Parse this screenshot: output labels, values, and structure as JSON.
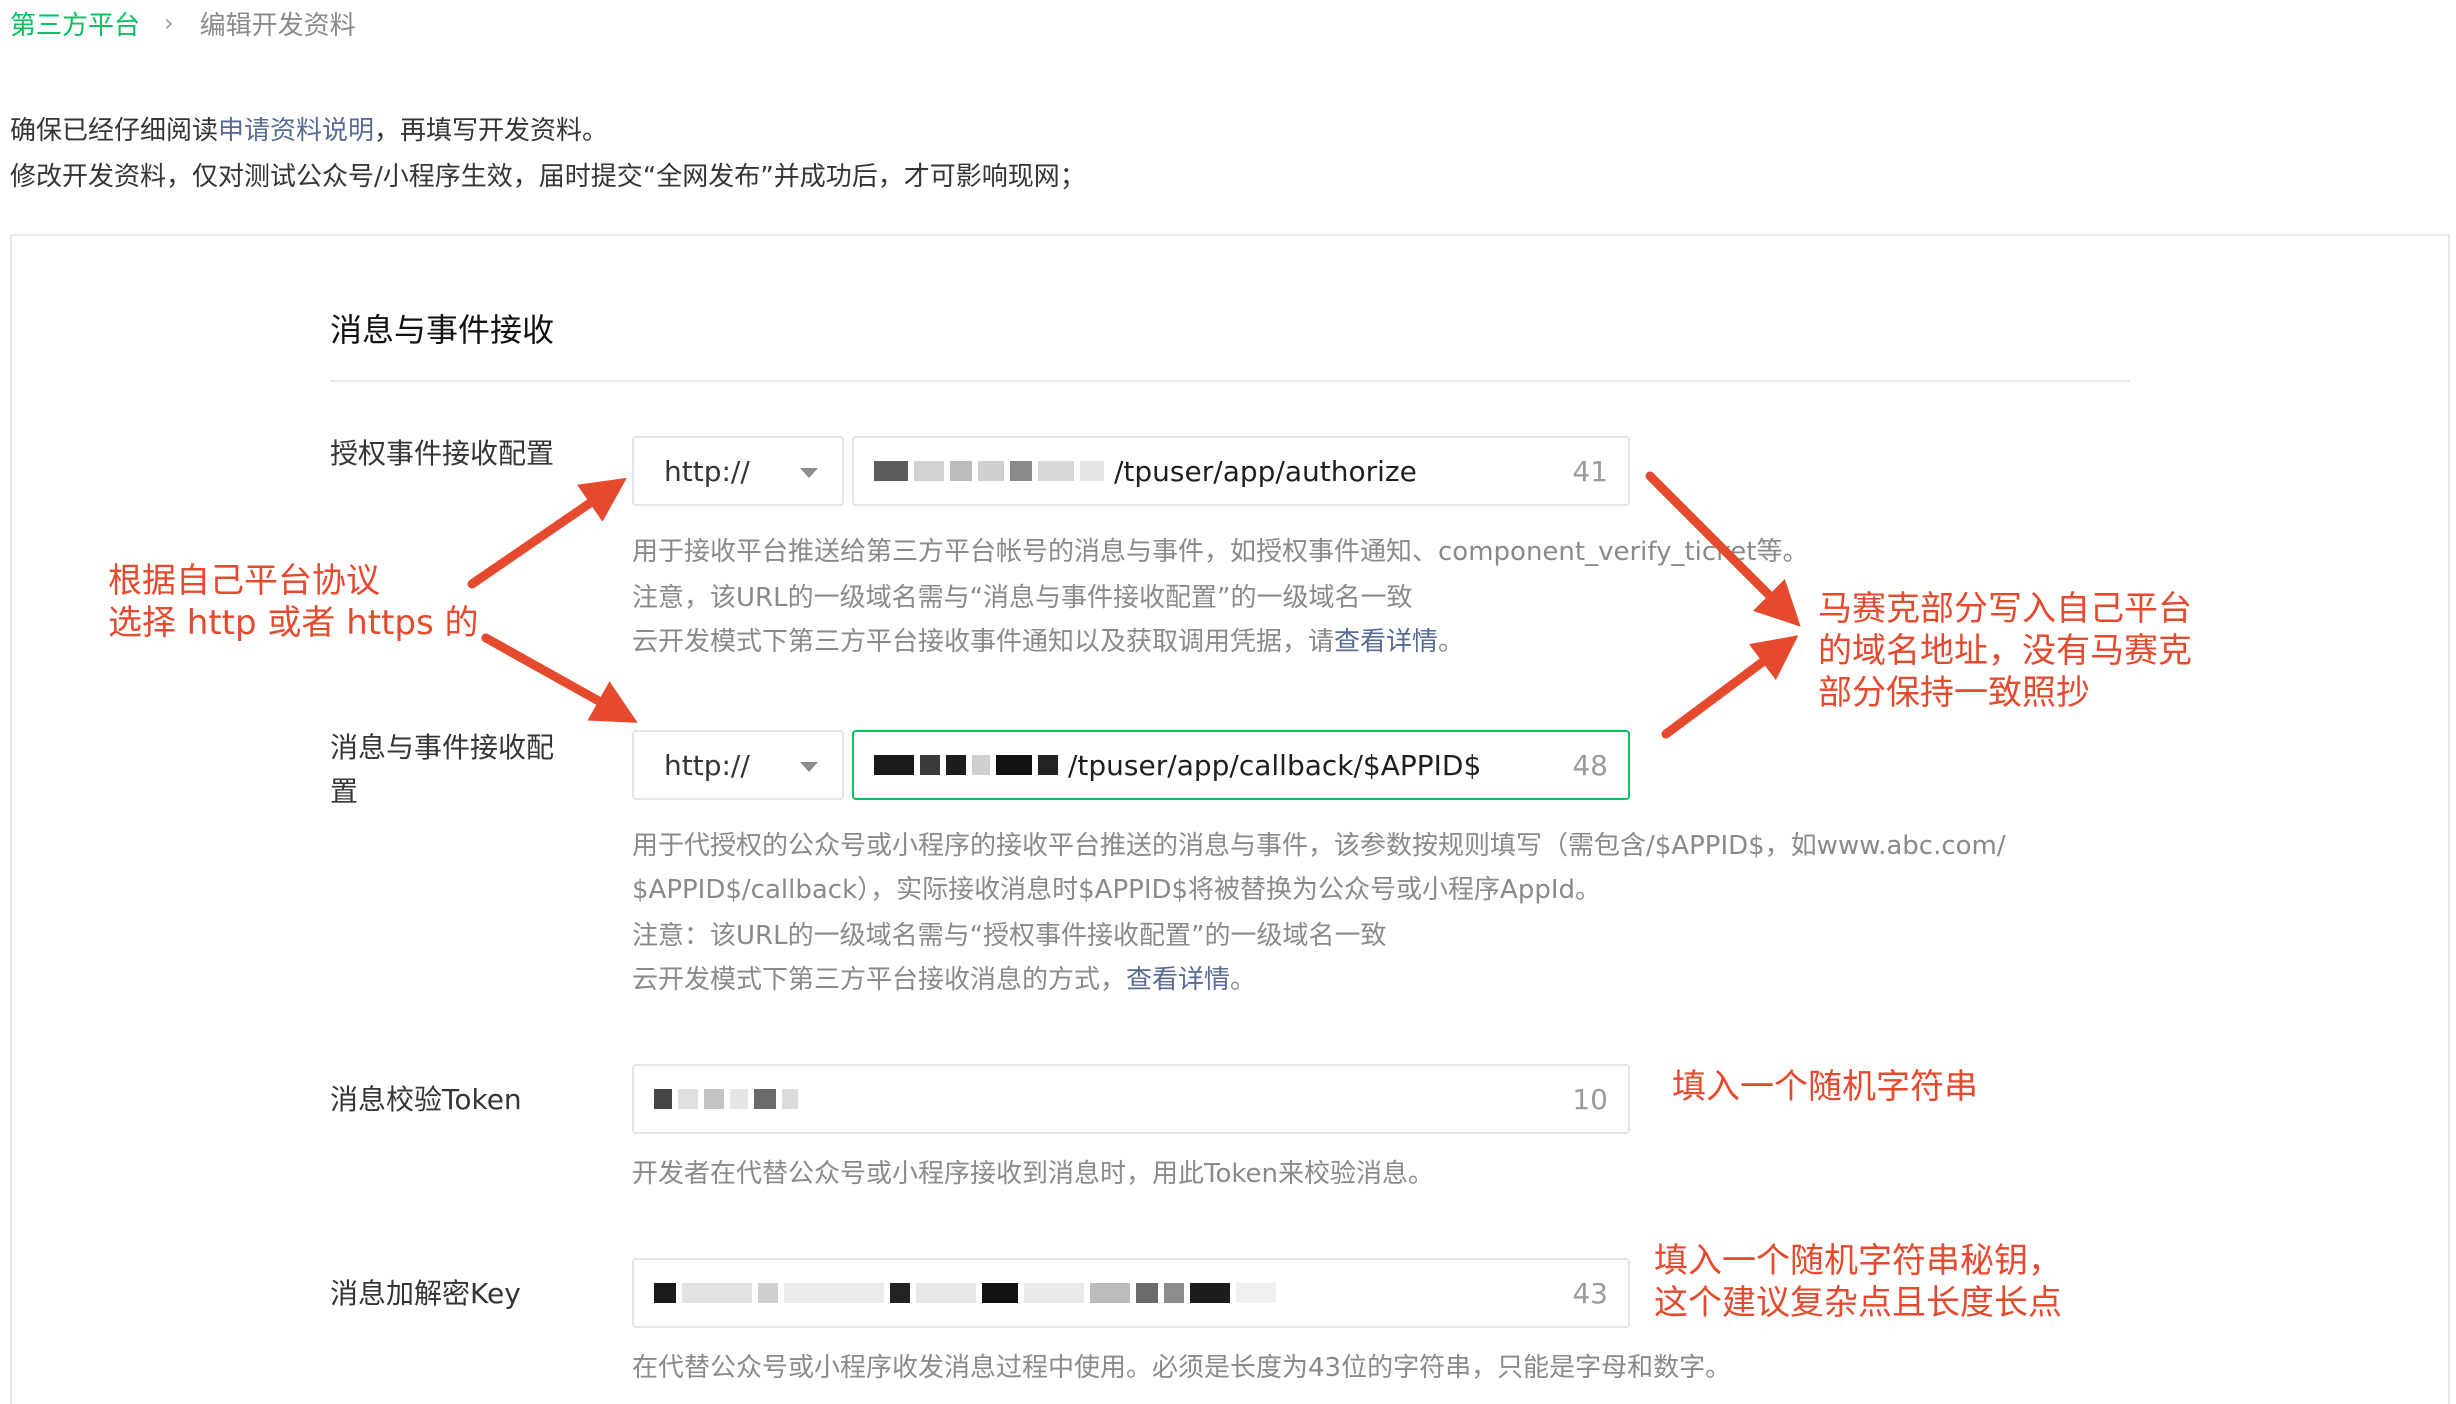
{
  "breadcrumb": {
    "root": "第三方平台",
    "separator": "›",
    "current": "编辑开发资料"
  },
  "intro": {
    "line1_prefix": "确保已经仔细阅读",
    "line1_link": "申请资料说明",
    "line1_suffix": "，再填写开发资料。",
    "line2": "修改开发资料，仅对测试公众号/小程序生效，届时提交“全网发布”并成功后，才可影响现网；"
  },
  "section": {
    "title": "消息与事件接收"
  },
  "fields": {
    "authorize": {
      "label": "授权事件接收配置",
      "protocol": "http://",
      "value_visible": "/tpuser/app/authorize",
      "count": "41",
      "desc1": "用于接收平台推送给第三方平台帐号的消息与事件，如授权事件通知、component_verify_ticket等。",
      "desc2": "注意，该URL的一级域名需与“消息与事件接收配置”的一级域名一致",
      "desc3_prefix": "云开发模式下第三方平台接收事件通知以及获取调用凭据，请",
      "desc3_link": "查看详情",
      "desc3_suffix": "。"
    },
    "callback": {
      "label_line1": "消息与事件接收配",
      "label_line2": "置",
      "protocol": "http://",
      "value_visible": "/tpuser/app/callback/$APPID$",
      "count": "48",
      "desc1": "用于代授权的公众号或小程序的接收平台推送的消息与事件，该参数按规则填写（需包含/$APPID$，如www.abc.com/",
      "desc2": "$APPID$/callback），实际接收消息时$APPID$将被替换为公众号或小程序AppId。",
      "desc3": "注意：该URL的一级域名需与“授权事件接收配置”的一级域名一致",
      "desc4_prefix": "云开发模式下第三方平台接收消息的方式，",
      "desc4_link": "查看详情",
      "desc4_suffix": "。"
    },
    "token": {
      "label": "消息校验Token",
      "count": "10",
      "desc": "开发者在代替公众号或小程序接收到消息时，用此Token来校验消息。"
    },
    "key": {
      "label": "消息加解密Key",
      "count": "43",
      "desc": "在代替公众号或小程序收发消息过程中使用。必须是长度为43位的字符串，只能是字母和数字。"
    }
  },
  "annotations": {
    "protocol_line1": "根据自己平台协议",
    "protocol_line2": "选择 http 或者 https 的",
    "domain_line1": "马赛克部分写入自己平台",
    "domain_line2": "的域名地址，没有马赛克",
    "domain_line3": "部分保持一致照抄",
    "token_note": "填入一个随机字符串",
    "key_line1": "填入一个随机字符串秘钥，",
    "key_line2": "这个建议复杂点且长度长点"
  },
  "colors": {
    "brand_green": "#07c160",
    "link_blue": "#576b95",
    "annotation_red": "#e64a2e"
  }
}
